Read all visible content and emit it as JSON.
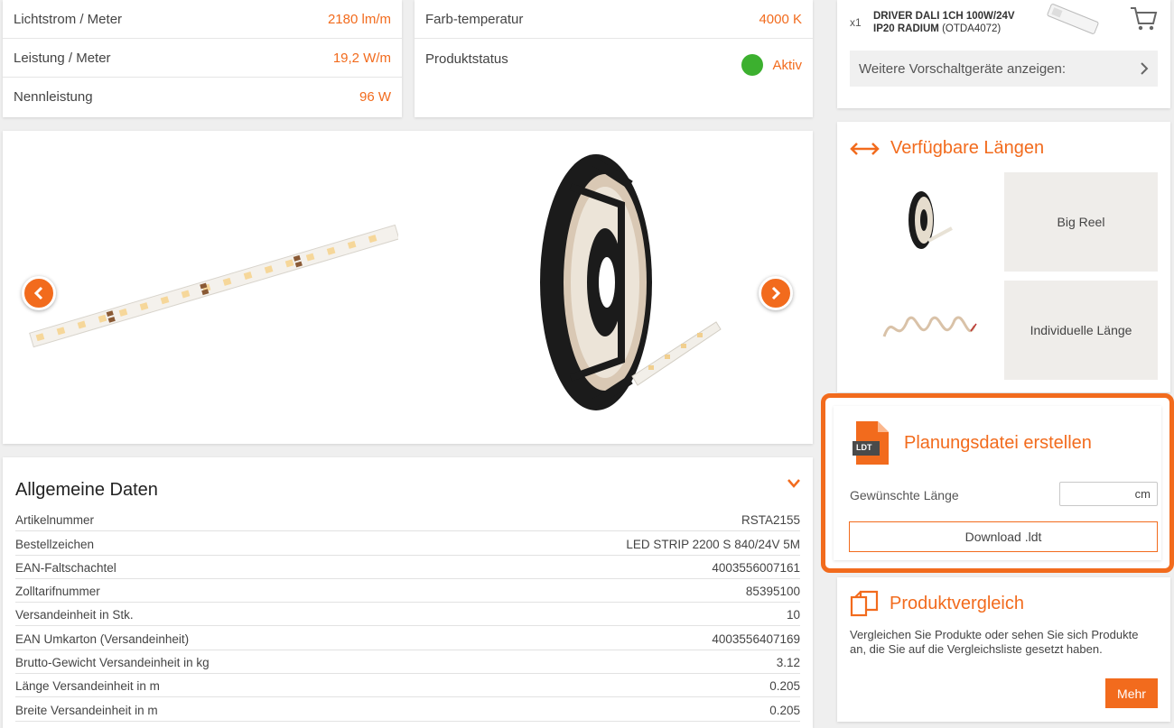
{
  "specs_left": [
    {
      "label": "Lichtstrom / Meter",
      "value": "2180 lm/m"
    },
    {
      "label": "Leistung / Meter",
      "value": "19,2 W/m"
    },
    {
      "label": "Nennleistung",
      "value": "96 W"
    }
  ],
  "specs_right": {
    "color_temp_label": "Farb-temperatur",
    "color_temp_value": "4000 K",
    "status_label": "Produktstatus",
    "status_value": "Aktiv"
  },
  "general": {
    "title": "Allgemeine Daten",
    "rows": [
      {
        "label": "Artikelnummer",
        "value": "RSTA2155"
      },
      {
        "label": "Bestellzeichen",
        "value": "LED STRIP 2200 S 840/24V 5M"
      },
      {
        "label": "EAN-Faltschachtel",
        "value": "4003556007161"
      },
      {
        "label": "Zolltarifnummer",
        "value": "85395100"
      },
      {
        "label": "Versandeinheit in Stk.",
        "value": "10"
      },
      {
        "label": "EAN Umkarton (Versandeinheit)",
        "value": "4003556407169"
      },
      {
        "label": "Brutto-Gewicht Versandeinheit in kg",
        "value": "3.12"
      },
      {
        "label": "Länge Versandeinheit in m",
        "value": "0.205"
      },
      {
        "label": "Breite Versandeinheit in m",
        "value": "0.205"
      }
    ]
  },
  "driver": {
    "qty": "x1",
    "name_line1": "DRIVER DALI 1CH 100W/24V",
    "name_line2": "IP20 RADIUM",
    "code": "(OTDA4072)",
    "more_label": "Weitere Vorschaltgeräte anzeigen:"
  },
  "lengths": {
    "title": "Verfügbare Längen",
    "options": [
      "Big Reel",
      "Individuelle Länge"
    ]
  },
  "planning": {
    "title": "Planungsdatei erstellen",
    "file_badge": "LDT",
    "length_label": "Gewünschte Länge",
    "length_unit": "cm",
    "download_label": "Download .ldt"
  },
  "compare": {
    "title": "Produktvergleich",
    "text": "Vergleichen Sie Produkte oder sehen Sie sich Produkte an, die Sie auf die Vergleichsliste gesetzt haben.",
    "more_label": "Mehr"
  },
  "colors": {
    "accent": "#f26b1d",
    "status_active": "#3cb02f"
  }
}
